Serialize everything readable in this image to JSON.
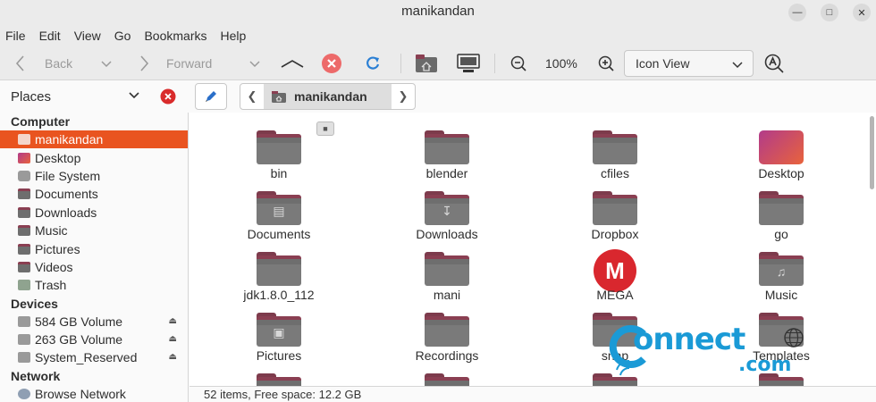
{
  "window": {
    "title": "manikandan"
  },
  "menu": [
    "File",
    "Edit",
    "View",
    "Go",
    "Bookmarks",
    "Help"
  ],
  "toolbar": {
    "back_label": "Back",
    "forward_label": "Forward",
    "zoom_value": "100%",
    "view_mode": "Icon View"
  },
  "places": {
    "header": "Places"
  },
  "breadcrumb": {
    "current": "manikandan"
  },
  "sidebar": {
    "computer_header": "Computer",
    "computer_items": [
      {
        "label": "manikandan",
        "icon": "home-icon",
        "active": true
      },
      {
        "label": "Desktop",
        "icon": "desktop-icon"
      },
      {
        "label": "File System",
        "icon": "drive-icon"
      },
      {
        "label": "Documents",
        "icon": "documents-folder-icon"
      },
      {
        "label": "Downloads",
        "icon": "downloads-folder-icon"
      },
      {
        "label": "Music",
        "icon": "music-folder-icon"
      },
      {
        "label": "Pictures",
        "icon": "pictures-folder-icon"
      },
      {
        "label": "Videos",
        "icon": "videos-folder-icon"
      },
      {
        "label": "Trash",
        "icon": "trash-icon"
      }
    ],
    "devices_header": "Devices",
    "device_items": [
      {
        "label": "584 GB Volume",
        "icon": "drive-icon"
      },
      {
        "label": "263 GB Volume",
        "icon": "drive-icon"
      },
      {
        "label": "System_Reserved",
        "icon": "drive-icon"
      }
    ],
    "network_header": "Network",
    "network_items": [
      {
        "label": "Browse Network",
        "icon": "network-icon"
      }
    ]
  },
  "files": [
    {
      "label": "bin",
      "icon": "folder-icon"
    },
    {
      "label": "blender",
      "icon": "folder-icon"
    },
    {
      "label": "cfiles",
      "icon": "folder-icon"
    },
    {
      "label": "Desktop",
      "icon": "desktop-icon"
    },
    {
      "label": "Documents",
      "icon": "documents-folder-icon"
    },
    {
      "label": "Downloads",
      "icon": "downloads-folder-icon"
    },
    {
      "label": "Dropbox",
      "icon": "folder-icon"
    },
    {
      "label": "go",
      "icon": "folder-icon"
    },
    {
      "label": "jdk1.8.0_112",
      "icon": "folder-icon"
    },
    {
      "label": "mani",
      "icon": "folder-icon"
    },
    {
      "label": "MEGA",
      "icon": "mega-icon"
    },
    {
      "label": "Music",
      "icon": "music-folder-icon"
    },
    {
      "label": "Pictures",
      "icon": "pictures-folder-icon"
    },
    {
      "label": "Recordings",
      "icon": "folder-icon"
    },
    {
      "label": "snap",
      "icon": "folder-icon"
    },
    {
      "label": "Templates",
      "icon": "templates-folder-icon"
    }
  ],
  "status": {
    "text": "52 items, Free space: 12.2 GB"
  },
  "watermark": {
    "text": "onnect",
    "sub": ".com"
  },
  "colors": {
    "accent": "#e95420",
    "folder": "#737373",
    "folder_top": "#8a3f52"
  }
}
